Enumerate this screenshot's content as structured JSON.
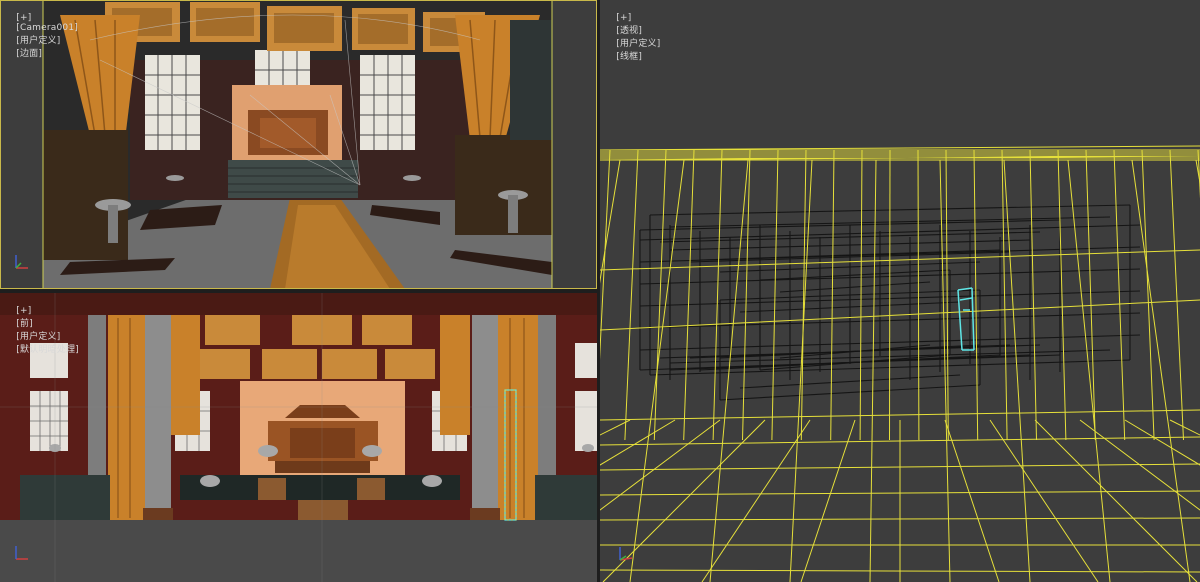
{
  "viewports": {
    "camera": {
      "label_plus": "[+]",
      "label_view": "[Camera001]",
      "label_shading": "[用户定义]",
      "label_mode": "[边面]"
    },
    "front": {
      "label_plus": "[+]",
      "label_view": "[前]",
      "label_shading": "[用户定义]",
      "label_mode": "[默认明暗处理]"
    },
    "perspective": {
      "label_plus": "[+]",
      "label_view": "[透视]",
      "label_shading": "[用户定义]",
      "label_mode": "[线框]"
    }
  },
  "colors": {
    "viewport_bg": "#3d3d3d",
    "active_border": "#c9b94a",
    "wireframe_yellow": "#e6e03a",
    "wireframe_dark": "#151515",
    "selection_cyan": "#5fe6e6",
    "curtain_orange": "#c9812a",
    "pillar_grey": "#8d8d8d"
  },
  "icons": {
    "axis_gizmo": "axis-tripod-icon"
  }
}
